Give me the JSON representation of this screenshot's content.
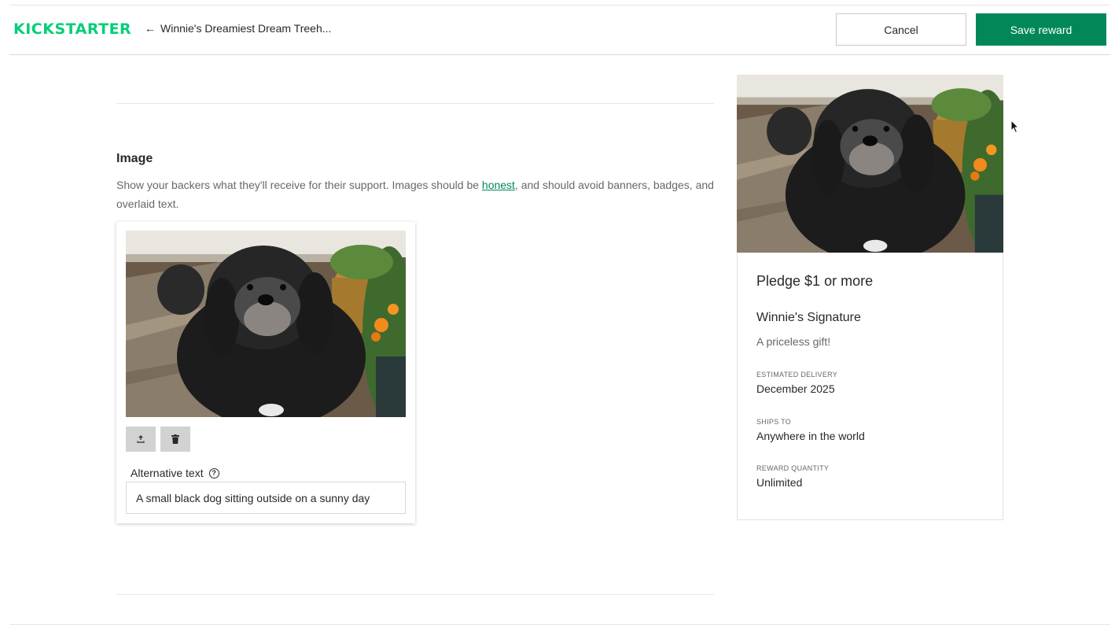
{
  "header": {
    "logo": "KICKSTARTER",
    "back_arrow": "←",
    "back_label": "Winnie's Dreamiest Dream Treeh...",
    "cancel_label": "Cancel",
    "save_label": "Save reward",
    "accent_color": "#028858",
    "logo_color": "#05ce78"
  },
  "image_section": {
    "title": "Image",
    "desc_before": "Show your backers what they'll receive for their support. Images should be ",
    "desc_link": "honest",
    "desc_after": ", and should avoid banners, badges, and overlaid text.",
    "upload_icon": "upload-icon",
    "delete_icon": "trash-icon",
    "alt_label": "Alternative text",
    "help_icon": "?",
    "alt_value": "A small black dog sitting outside on a sunny day"
  },
  "preview": {
    "pledge": "Pledge $1 or more",
    "title": "Winnie's Signature",
    "description": "A priceless gift!",
    "delivery_label": "ESTIMATED DELIVERY",
    "delivery_value": "December 2025",
    "ships_label": "SHIPS TO",
    "ships_value": "Anywhere in the world",
    "quantity_label": "REWARD QUANTITY",
    "quantity_value": "Unlimited"
  }
}
